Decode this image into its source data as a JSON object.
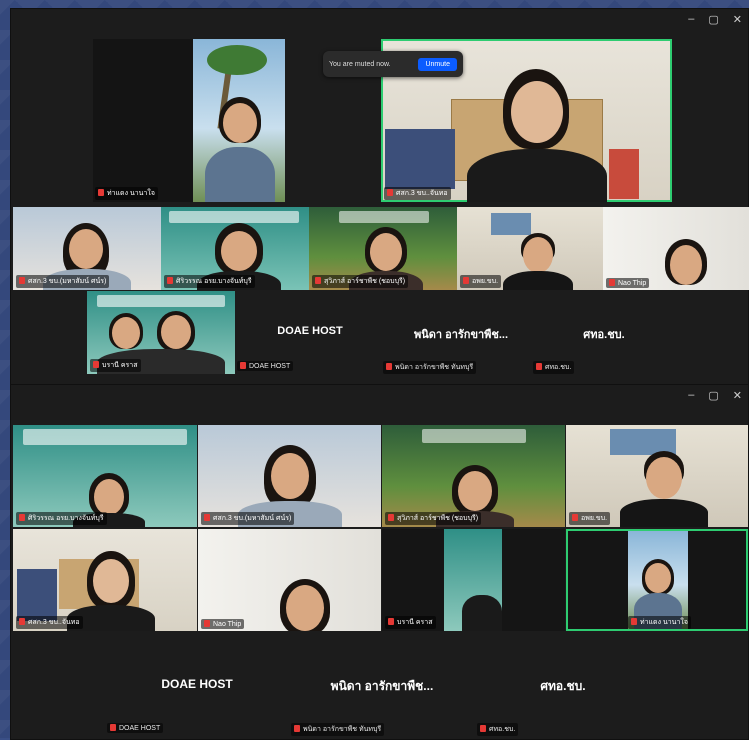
{
  "window_controls": {
    "minimize": "–",
    "maximize": "▢",
    "close": "✕"
  },
  "toast": {
    "message": "You are muted now.",
    "button": "Unmute"
  },
  "top": {
    "tiles": [
      {
        "name": "ท่าแดง นานาใจ"
      },
      {
        "name": "ศสก.3 ขบ..จันทอ"
      },
      {
        "name": "ศสก.3 ขบ.(มหาสัมน์ ศน์ร)"
      },
      {
        "name": "ศิริวรรณ อรย.บางจันท์บุรี"
      },
      {
        "name": "สุวิภาส์ อาร์ชาพืช (ชอบบุรี)"
      },
      {
        "name": "อพย.ขบ."
      },
      {
        "name": "Nao Thip"
      },
      {
        "name": "บรานี คราส"
      }
    ],
    "cards": [
      {
        "title": "DOAE HOST",
        "tag": "DOAE HOST"
      },
      {
        "title": "พนิดา อารักขาพืช...",
        "tag": "พนิดา อารักขาพืช ทันทบุรี"
      },
      {
        "title": "ศทอ.ชบ.",
        "tag": "ศทอ.ชบ."
      }
    ]
  },
  "bottom": {
    "tiles": [
      {
        "name": "ศิริวรรณ อรย.บางจันท์บุรี"
      },
      {
        "name": "ศสก.3 ขบ.(มหาสัมน์ ศน์ร)"
      },
      {
        "name": "สุวิภาส์ อาร์ชาพืช (ชอบบุรี)"
      },
      {
        "name": "อพย.ขบ."
      },
      {
        "name": "ศสก.3 ขบ..จันทอ"
      },
      {
        "name": "Nao Thip"
      },
      {
        "name": "บรานี คราส"
      },
      {
        "name": "ท่าแดง นานาใจ"
      }
    ],
    "cards": [
      {
        "title": "DOAE HOST",
        "tag": "DOAE HOST"
      },
      {
        "title": "พนิดา อารักขาพืช...",
        "tag": "พนิดา อารักขาพืช ทันทบุรี"
      },
      {
        "title": "ศทอ.ชบ.",
        "tag": "ศทอ.ชบ."
      }
    ]
  }
}
